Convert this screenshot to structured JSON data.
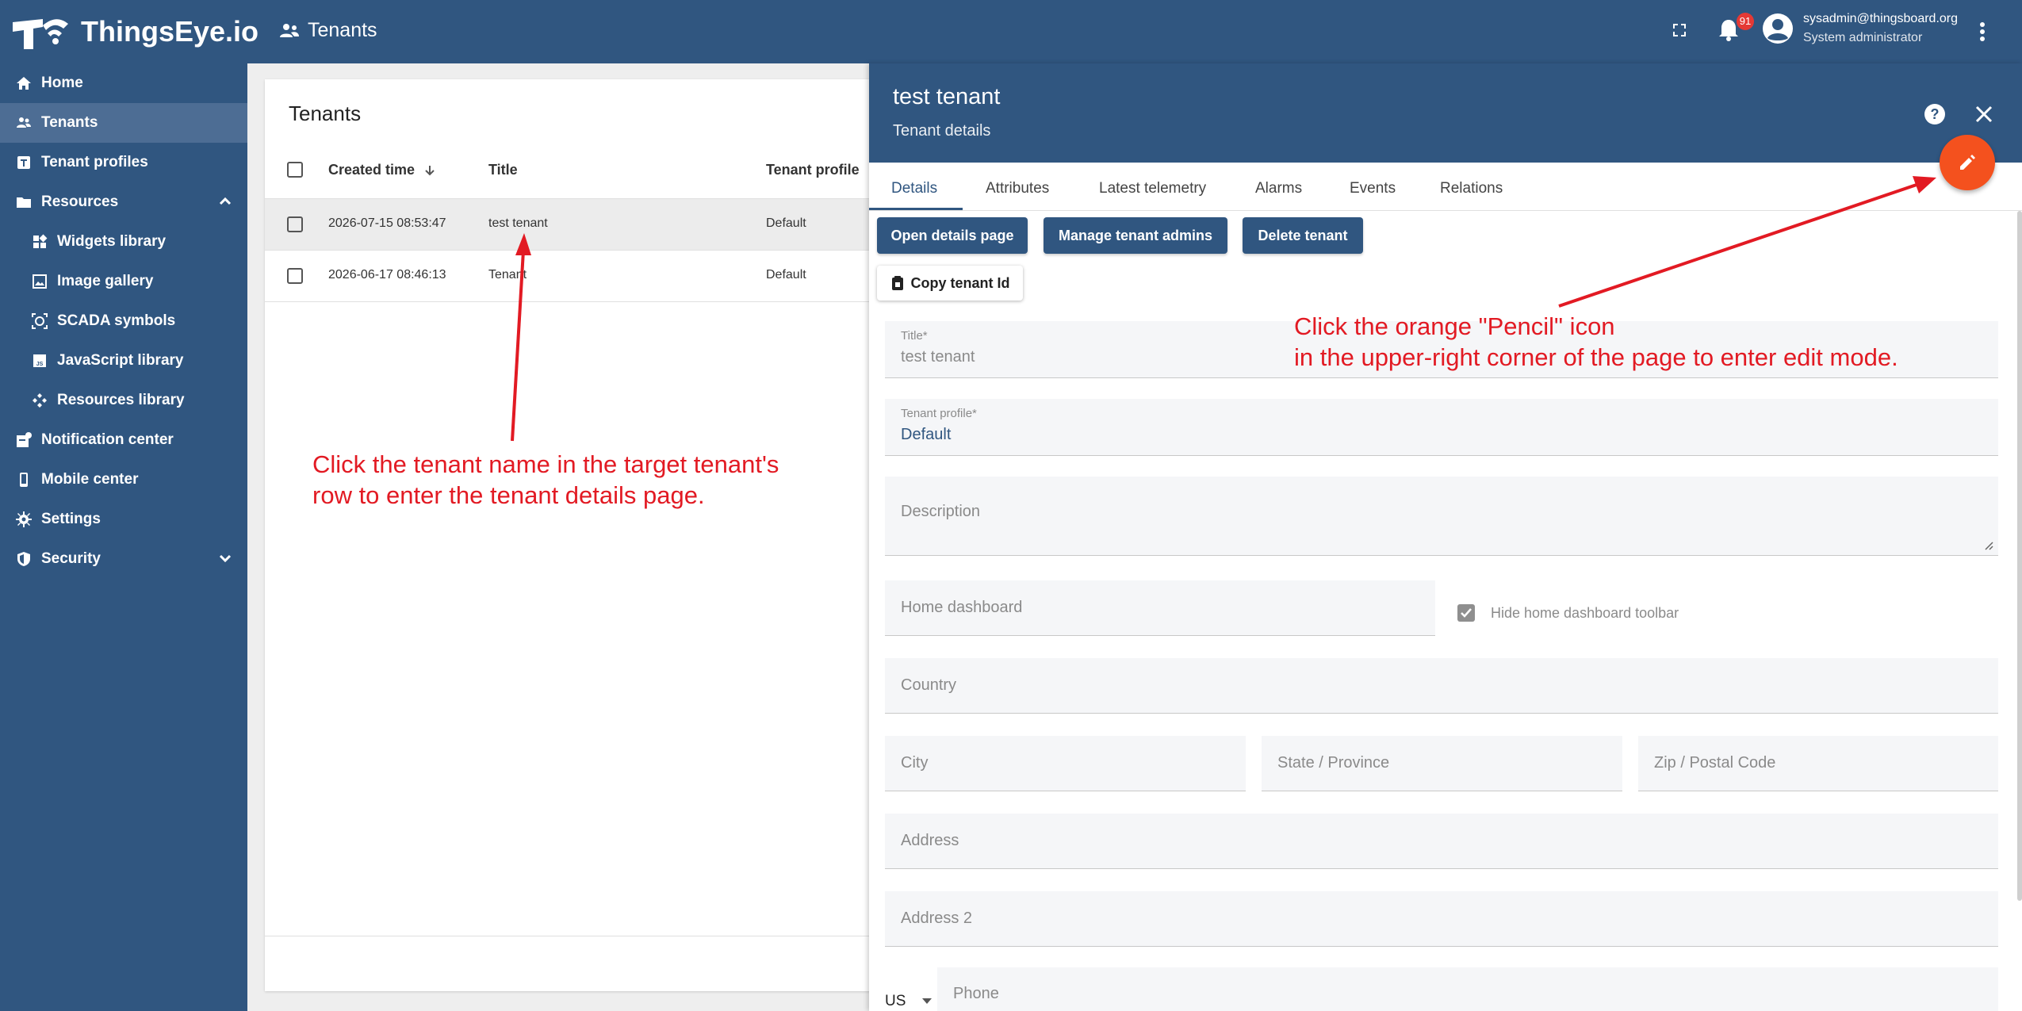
{
  "app": {
    "brand": "ThingsEye.io",
    "page_title": "Tenants",
    "notification_count": "91"
  },
  "user": {
    "email": "sysadmin@thingsboard.org",
    "role": "System administrator"
  },
  "colors": {
    "primary": "#305680",
    "accent": "#f4511e",
    "annotation": "#e21a23"
  },
  "sidebar": {
    "items": [
      {
        "label": "Home",
        "icon": "home-icon"
      },
      {
        "label": "Tenants",
        "icon": "people-icon",
        "active": true
      },
      {
        "label": "Tenant profiles",
        "icon": "tenant-profile-icon"
      },
      {
        "label": "Resources",
        "icon": "folder-icon",
        "expanded": true
      },
      {
        "label": "Widgets library",
        "icon": "widgets-icon"
      },
      {
        "label": "Image gallery",
        "icon": "image-icon"
      },
      {
        "label": "SCADA symbols",
        "icon": "scada-icon"
      },
      {
        "label": "JavaScript library",
        "icon": "javascript-icon"
      },
      {
        "label": "Resources library",
        "icon": "resources-icon"
      },
      {
        "label": "Notification center",
        "icon": "notification-icon"
      },
      {
        "label": "Mobile center",
        "icon": "mobile-icon"
      },
      {
        "label": "Settings",
        "icon": "gear-icon"
      },
      {
        "label": "Security",
        "icon": "shield-icon",
        "expanded": false
      }
    ]
  },
  "tenants_table": {
    "title": "Tenants",
    "columns": [
      "Created time",
      "Title",
      "Tenant profile"
    ],
    "rows": [
      {
        "created": "2026-07-15 08:53:47",
        "title": "test tenant",
        "profile": "Default"
      },
      {
        "created": "2026-06-17 08:46:13",
        "title": "Tenant",
        "profile": "Default"
      }
    ]
  },
  "details": {
    "title": "test tenant",
    "subtitle": "Tenant details",
    "tabs": [
      "Details",
      "Attributes",
      "Latest telemetry",
      "Alarms",
      "Events",
      "Relations"
    ],
    "buttons": {
      "open_details": "Open details page",
      "manage_admins": "Manage tenant admins",
      "delete": "Delete tenant",
      "copy_id": "Copy tenant Id"
    },
    "fields": {
      "title_label": "Title*",
      "title_value": "test tenant",
      "profile_label": "Tenant profile*",
      "profile_value": "Default",
      "description": "Description",
      "home_dashboard": "Home dashboard",
      "hide_toolbar": "Hide home dashboard toolbar",
      "country": "Country",
      "city": "City",
      "state": "State / Province",
      "zip": "Zip / Postal Code",
      "address": "Address",
      "address2": "Address 2",
      "phone_country": "US",
      "phone": "Phone"
    }
  },
  "annotations": {
    "left_1": "Click the tenant name in the target tenant's",
    "left_2": "row to enter the tenant details page.",
    "right_1": "Click the orange \"Pencil\" icon",
    "right_2": "in the upper-right corner of the page to enter edit mode."
  }
}
